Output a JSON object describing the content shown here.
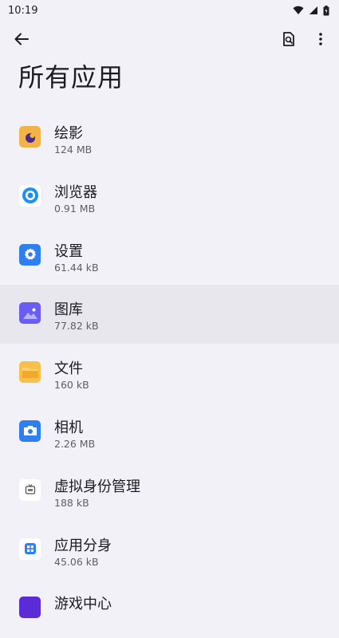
{
  "status": {
    "time": "10:19"
  },
  "header": {
    "title": "所有应用"
  },
  "apps": [
    {
      "name": "绘影",
      "size": "124 MB",
      "icon": "paint-app-icon"
    },
    {
      "name": "浏览器",
      "size": "0.91 MB",
      "icon": "browser-app-icon"
    },
    {
      "name": "设置",
      "size": "61.44 kB",
      "icon": "settings-app-icon"
    },
    {
      "name": "图库",
      "size": "77.82 kB",
      "icon": "gallery-app-icon"
    },
    {
      "name": "文件",
      "size": "160 kB",
      "icon": "files-app-icon"
    },
    {
      "name": "相机",
      "size": "2.26 MB",
      "icon": "camera-app-icon"
    },
    {
      "name": "虚拟身份管理",
      "size": "188 kB",
      "icon": "virtual-identity-app-icon"
    },
    {
      "name": "应用分身",
      "size": "45.06 kB",
      "icon": "app-clone-app-icon"
    },
    {
      "name": "游戏中心",
      "size": "",
      "icon": "game-center-app-icon"
    }
  ]
}
